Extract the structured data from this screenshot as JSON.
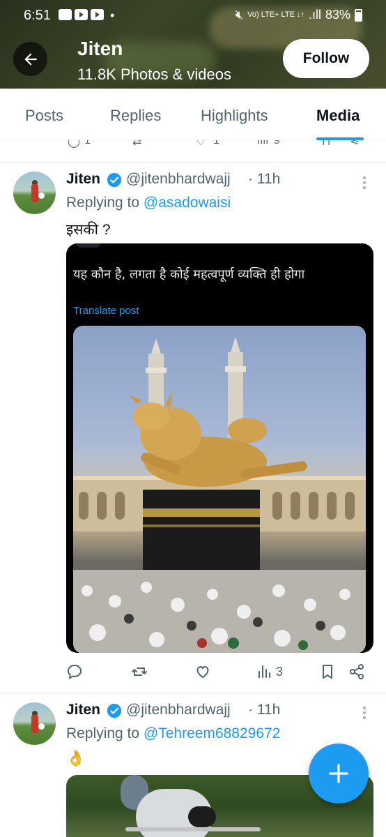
{
  "status_bar": {
    "time": "6:51",
    "network": "Vo) LTE+ LTE ↓↑",
    "battery": "83%"
  },
  "header": {
    "name": "Jiten",
    "subtitle": "11.8K Photos & videos",
    "follow_label": "Follow"
  },
  "tabs": [
    {
      "label": "Posts",
      "active": false
    },
    {
      "label": "Replies",
      "active": false
    },
    {
      "label": "Highlights",
      "active": false
    },
    {
      "label": "Media",
      "active": true
    }
  ],
  "previous_tweet_actions": {
    "replies": "1",
    "likes": "1",
    "views": "9"
  },
  "tweets": [
    {
      "name": "Jiten",
      "handle": "@jitenbhardwajj",
      "time": "· 11h",
      "replying_prefix": "Replying to ",
      "replying_to": "@asadowaisi",
      "text": "इसकी ?",
      "media_text": "यह कौन है, लगता है कोई महत्वपूर्ण व्यक्ति ही होगा",
      "media_translate": "Translate post",
      "views": "3"
    },
    {
      "name": "Jiten",
      "handle": "@jitenbhardwajj",
      "time": "· 11h",
      "replying_prefix": "Replying to ",
      "replying_to": "@Tehreem68829672",
      "text": "👌"
    }
  ],
  "colors": {
    "accent": "#1d9bf0",
    "text_primary": "#0f1419",
    "text_secondary": "#536471"
  },
  "icons": [
    "back-arrow-icon",
    "verified-badge-icon",
    "more-icon",
    "reply-icon",
    "retweet-icon",
    "like-icon",
    "views-icon",
    "bookmark-icon",
    "share-icon",
    "compose-plus-icon"
  ]
}
